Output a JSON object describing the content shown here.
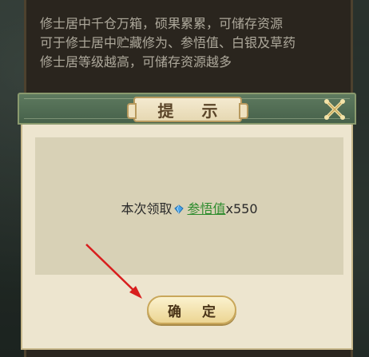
{
  "background_info": {
    "lines": [
      "修士居中千仓万箱，硕果累累，可储存资源",
      "可于修士居中贮藏修为、参悟值、白银及草药",
      "修士居等级越高，可储存资源越多"
    ]
  },
  "dialog": {
    "title": "提 示",
    "reward": {
      "prefix": "本次领取",
      "icon": "blue-gem-icon",
      "item_name": "参悟值",
      "amount": "x550"
    },
    "confirm_label": "确 定"
  },
  "colors": {
    "header_green": "#46614a",
    "body_bg": "#ede5cf",
    "content_bg": "#d8d1b6",
    "link_green": "#2e8c2e",
    "arrow_red": "#d81e1e"
  }
}
